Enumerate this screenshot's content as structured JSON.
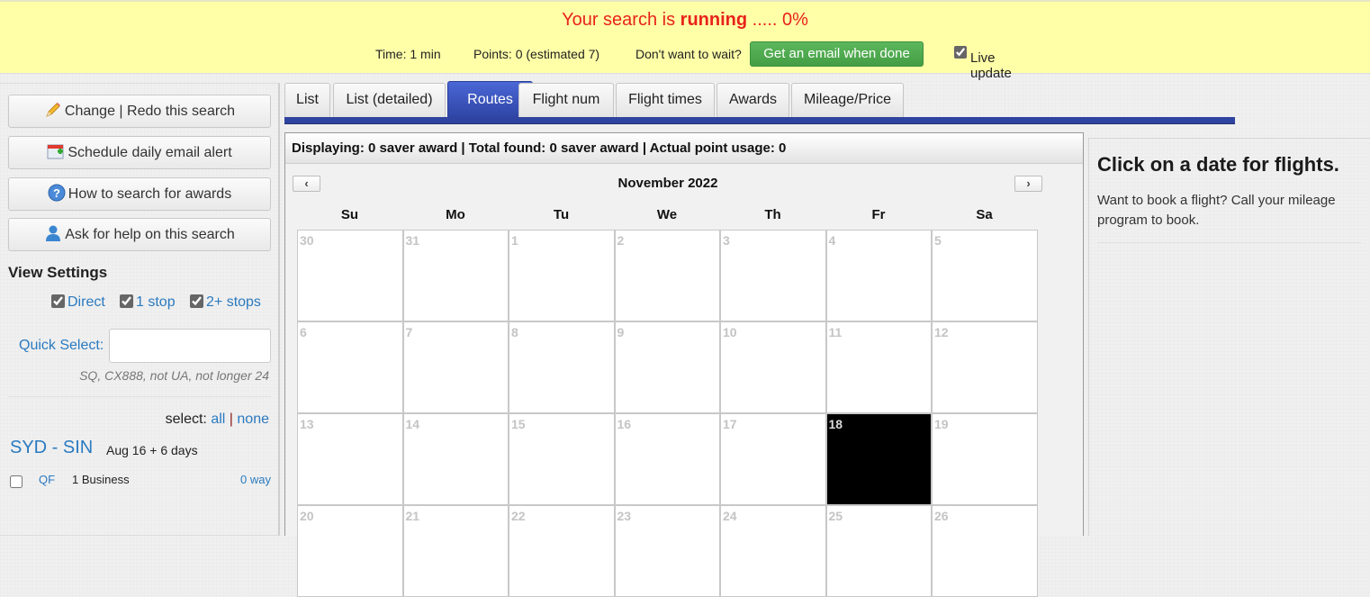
{
  "banner": {
    "title_prefix": "Your search is ",
    "title_status": "running",
    "title_suffix": " ..... 0%",
    "progress_percent": 0,
    "time": "Time: 1 min",
    "points": "Points: 0 (estimated 7)",
    "wait_prompt": "Don't want to wait?",
    "email_button": "Get an email when done",
    "live_update_label": "Live update",
    "live_update_checked": true
  },
  "sidebar": {
    "buttons": [
      {
        "label": "Change | Redo this search",
        "icon": "pencil-icon"
      },
      {
        "label": "Schedule daily email alert",
        "icon": "calendar-add-icon"
      },
      {
        "label": "How to search for awards",
        "icon": "help-icon"
      },
      {
        "label": "Ask for help on this search",
        "icon": "user-icon"
      }
    ],
    "view_settings_title": "View Settings",
    "stops": [
      {
        "label": "Direct",
        "checked": true
      },
      {
        "label": "1 stop",
        "checked": true
      },
      {
        "label": "2+ stops",
        "checked": true
      }
    ],
    "quick_select_label": "Quick Select:",
    "quick_select_value": "",
    "quick_select_hint": "SQ, CX888, not UA, not longer 24",
    "select_label": "select:",
    "select_all": "all",
    "select_sep": "|",
    "select_none": "none",
    "route": "SYD - SIN",
    "route_date": "Aug 16 + 6 days",
    "flights": [
      {
        "airline": "QF",
        "cabin": "1 Business",
        "way": "0 way",
        "checked": false
      }
    ]
  },
  "tabs": [
    {
      "label": "List",
      "active": false
    },
    {
      "label": "List (detailed)",
      "active": false
    },
    {
      "label": "Routes",
      "active": true
    },
    {
      "label": "Flight num",
      "active": false
    },
    {
      "label": "Flight times",
      "active": false
    },
    {
      "label": "Awards",
      "active": false
    },
    {
      "label": "Mileage/Price",
      "active": false
    }
  ],
  "main": {
    "summary": "Displaying: 0 saver award | Total found: 0 saver award | Actual point usage: 0",
    "prev_label": "‹",
    "next_label": "›",
    "month": "November 2022",
    "weekdays": [
      "Su",
      "Mo",
      "Tu",
      "We",
      "Th",
      "Fr",
      "Sa"
    ],
    "weeks": [
      [
        "30",
        "31",
        "1",
        "2",
        "3",
        "4",
        "5"
      ],
      [
        "6",
        "7",
        "8",
        "9",
        "10",
        "11",
        "12"
      ],
      [
        "13",
        "14",
        "15",
        "16",
        "17",
        "18",
        "19"
      ],
      [
        "20",
        "21",
        "22",
        "23",
        "24",
        "25",
        "26"
      ]
    ],
    "selected_date": "18"
  },
  "info": {
    "title": "Click on a date for flights.",
    "text": "Want to book a flight? Call your mileage program to book."
  }
}
